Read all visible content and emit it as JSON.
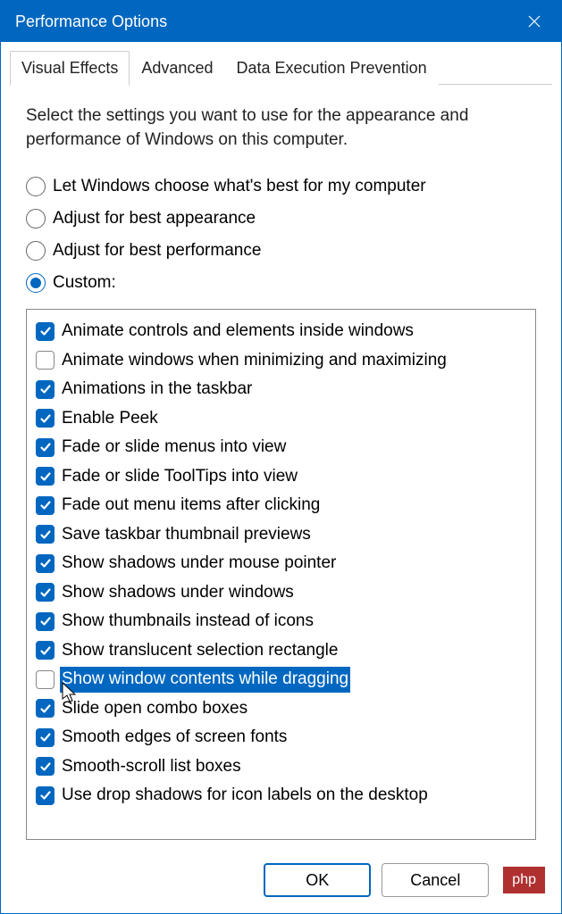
{
  "window": {
    "title": "Performance Options"
  },
  "tabs": [
    {
      "label": "Visual Effects",
      "active": true
    },
    {
      "label": "Advanced",
      "active": false
    },
    {
      "label": "Data Execution Prevention",
      "active": false
    }
  ],
  "description": "Select the settings you want to use for the appearance and performance of Windows on this computer.",
  "radios": [
    {
      "label": "Let Windows choose what's best for my computer",
      "checked": false
    },
    {
      "label": "Adjust for best appearance",
      "checked": false
    },
    {
      "label": "Adjust for best performance",
      "checked": false
    },
    {
      "label": "Custom:",
      "checked": true
    }
  ],
  "checkboxes": [
    {
      "label": "Animate controls and elements inside windows",
      "checked": true,
      "selected": false
    },
    {
      "label": "Animate windows when minimizing and maximizing",
      "checked": false,
      "selected": false
    },
    {
      "label": "Animations in the taskbar",
      "checked": true,
      "selected": false
    },
    {
      "label": "Enable Peek",
      "checked": true,
      "selected": false
    },
    {
      "label": "Fade or slide menus into view",
      "checked": true,
      "selected": false
    },
    {
      "label": "Fade or slide ToolTips into view",
      "checked": true,
      "selected": false
    },
    {
      "label": "Fade out menu items after clicking",
      "checked": true,
      "selected": false
    },
    {
      "label": "Save taskbar thumbnail previews",
      "checked": true,
      "selected": false
    },
    {
      "label": "Show shadows under mouse pointer",
      "checked": true,
      "selected": false
    },
    {
      "label": "Show shadows under windows",
      "checked": true,
      "selected": false
    },
    {
      "label": "Show thumbnails instead of icons",
      "checked": true,
      "selected": false
    },
    {
      "label": "Show translucent selection rectangle",
      "checked": true,
      "selected": false
    },
    {
      "label": "Show window contents while dragging",
      "checked": false,
      "selected": true,
      "cursor": true
    },
    {
      "label": "Slide open combo boxes",
      "checked": true,
      "selected": false
    },
    {
      "label": "Smooth edges of screen fonts",
      "checked": true,
      "selected": false
    },
    {
      "label": "Smooth-scroll list boxes",
      "checked": true,
      "selected": false
    },
    {
      "label": "Use drop shadows for icon labels on the desktop",
      "checked": true,
      "selected": false
    }
  ],
  "buttons": {
    "ok": "OK",
    "cancel": "Cancel"
  },
  "watermark": "php"
}
